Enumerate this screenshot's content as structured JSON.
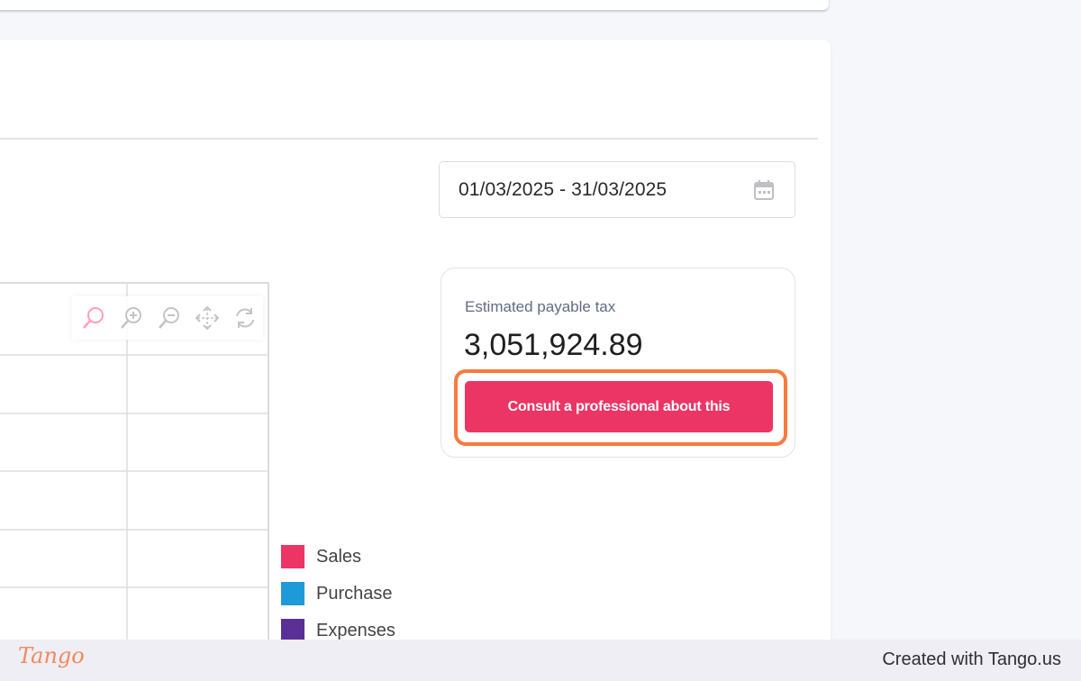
{
  "date_filter": {
    "value": "01/03/2025 - 31/03/2025",
    "icon": "calendar-icon"
  },
  "toolbox": {
    "tools": [
      {
        "icon": "search-icon",
        "color": "#ff9fb7"
      },
      {
        "icon": "zoom-in-icon",
        "color": "#c4c4c4"
      },
      {
        "icon": "zoom-out-icon",
        "color": "#c4c4c4"
      },
      {
        "icon": "move-icon",
        "color": "#c4c4c4"
      },
      {
        "icon": "refresh-icon",
        "color": "#c4c4c4"
      }
    ]
  },
  "legend": {
    "items": [
      {
        "label": "Sales",
        "color": "#ec3564"
      },
      {
        "label": "Purchase",
        "color": "#1e9ad8"
      },
      {
        "label": "Expenses",
        "color": "#5a3096"
      }
    ]
  },
  "tax_card": {
    "label": "Estimated payable tax",
    "value": "3,051,924.89",
    "button_label": "Consult a professional about this"
  },
  "footer": {
    "logo": "Tango",
    "text": "Created with Tango.us"
  },
  "colors": {
    "accent": "#ec3564",
    "highlight": "#f97a3e"
  }
}
